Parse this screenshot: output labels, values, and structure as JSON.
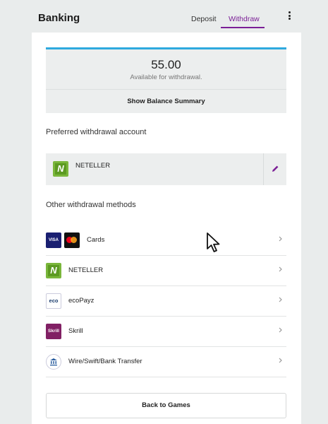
{
  "header": {
    "title": "Banking",
    "tabs": [
      {
        "label": "Deposit",
        "active": false
      },
      {
        "label": "Withdraw",
        "active": true
      }
    ],
    "menu_icon": "more-vertical-icon"
  },
  "balance": {
    "amount": "55.00",
    "caption": "Available for withdrawal.",
    "summary_button": "Show Balance Summary"
  },
  "preferred": {
    "heading": "Preferred withdrawal account",
    "account": {
      "name": "NETELLER",
      "logo_letter": "N",
      "icon": "neteller-logo"
    },
    "edit_icon": "pencil-icon"
  },
  "other": {
    "heading": "Other withdrawal methods",
    "methods": [
      {
        "label": "Cards",
        "icons": [
          "visa-logo",
          "mastercard-logo"
        ],
        "visa_text": "VISA"
      },
      {
        "label": "NETELLER",
        "logo_letter": "N",
        "icon": "neteller-logo"
      },
      {
        "label": "ecoPayz",
        "logo_text": "eco",
        "icon": "ecopayz-logo"
      },
      {
        "label": "Skrill",
        "logo_text": "Skrill",
        "icon": "skrill-logo"
      },
      {
        "label": "Wire/Swift/Bank Transfer",
        "icon": "bank-icon"
      }
    ]
  },
  "footer": {
    "back_button": "Back to Games"
  },
  "colors": {
    "accent": "#7b1f96",
    "balance_top_border": "#2ea9de",
    "neteller_green": "#7ab63b",
    "skrill_purple": "#812064",
    "visa_blue": "#1a1f71"
  }
}
